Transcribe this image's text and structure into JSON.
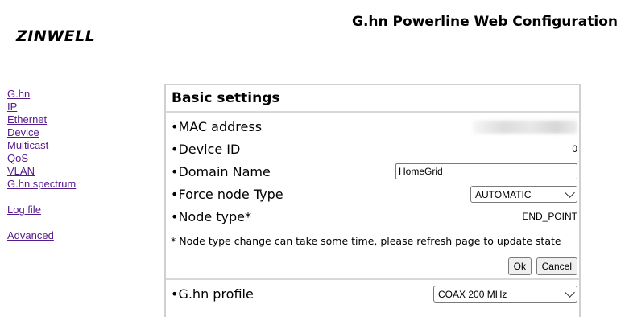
{
  "header": {
    "logo_text": "ZINWELL",
    "title": "G.hn Powerline Web Configuration"
  },
  "nav": {
    "items": [
      "G.hn",
      "IP",
      "Ethernet",
      "Device",
      "Multicast",
      "QoS",
      "VLAN",
      "G.hn spectrum"
    ],
    "log_file": "Log file",
    "advanced": "Advanced"
  },
  "basic_settings": {
    "title": "Basic settings",
    "mac_label": "•MAC address",
    "device_id_label": "•Device ID",
    "device_id_value": "0",
    "domain_name_label": "•Domain Name",
    "domain_name_value": "HomeGrid",
    "force_node_label": "•Force node Type",
    "force_node_value": "AUTOMATIC",
    "node_type_label": "•Node type*",
    "node_type_value": "END_POINT",
    "note": "* Node type change can take some time, please refresh page to update state",
    "ok_label": "Ok",
    "cancel_label": "Cancel"
  },
  "profile": {
    "label": "•G.hn profile",
    "value": "COAX 200 MHz"
  },
  "colors": {
    "link": "#551a8b",
    "panel_border": "#d0d0d0"
  }
}
